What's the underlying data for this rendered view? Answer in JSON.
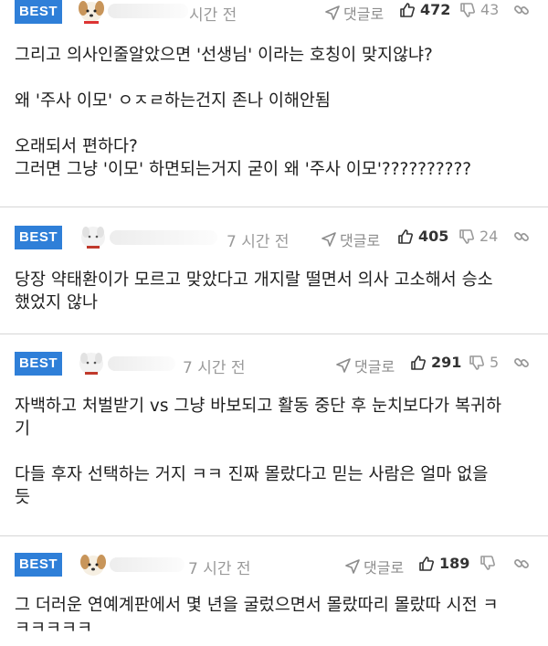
{
  "comments": [
    {
      "badge": "BEST",
      "time": "시간 전",
      "reply_label": "댓글로",
      "likes": "472",
      "dislikes": "43",
      "paragraphs": [
        "그리고 의사인줄알았으면 '선생님' 이라는 호칭이 맞지않냐?",
        "왜 '주사 이모' ㅇㅈㄹ하는건지 존나 이해안됨",
        "오래되서 편하다?\n그러면 그냥 '이모' 하면되는거지 굳이 왜 '주사 이모'??????????"
      ]
    },
    {
      "badge": "BEST",
      "time": "7 시간 전",
      "reply_label": "댓글로",
      "likes": "405",
      "dislikes": "24",
      "paragraphs": [
        "당장 약태환이가 모르고 맞았다고 개지랄 떨면서 의사 고소해서 승소\n했었지 않나"
      ]
    },
    {
      "badge": "BEST",
      "time": "7 시간 전",
      "reply_label": "댓글로",
      "likes": "291",
      "dislikes": "5",
      "paragraphs": [
        "자백하고 처벌받기 vs 그냥 바보되고 활동 중단 후 눈치보다가 복귀하\n기",
        "다들 후자 선택하는 거지 ㅋㅋ 진짜 몰랐다고 믿는 사람은 얼마 없을\n듯"
      ]
    },
    {
      "badge": "BEST",
      "time": "7 시간 전",
      "reply_label": "댓글로",
      "likes": "189",
      "dislikes": "",
      "paragraphs": [
        "그 더러운 연예계판에서 몇 년을 굴렀으면서 몰랐따리 몰랐따 시전 ㅋ\nㅋㅋㅋㅋㅋ"
      ]
    }
  ],
  "icons": {
    "reply": "arrow-reply-icon",
    "like": "thumbs-up-icon",
    "dislike": "thumbs-down-icon",
    "share": "link-icon"
  },
  "colors": {
    "badge": "#2f7fd8",
    "muted": "#9a9a9a",
    "divider": "#d6d6d6"
  }
}
